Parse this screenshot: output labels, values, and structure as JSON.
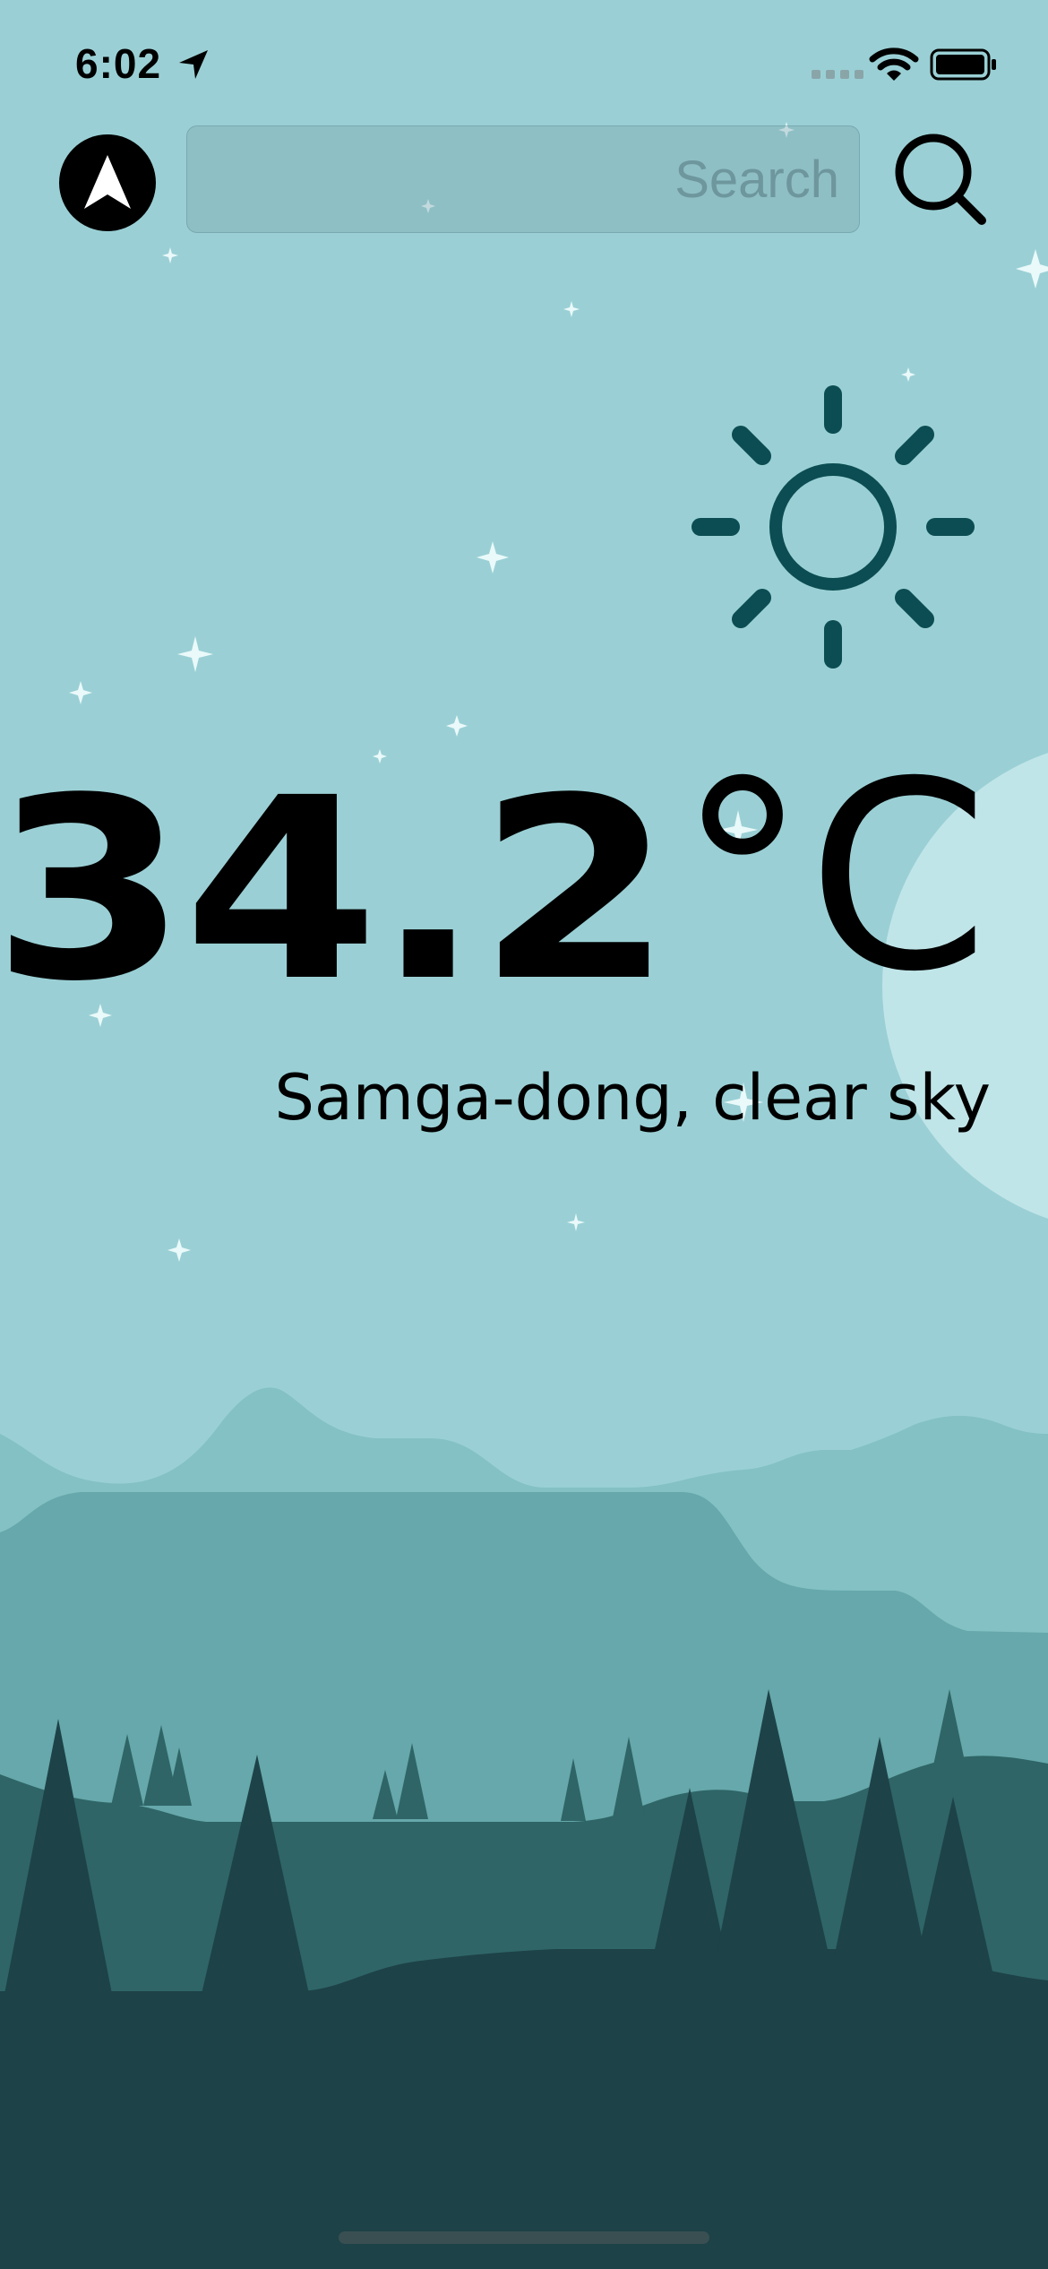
{
  "status_bar": {
    "time": "6:02",
    "icons": [
      "location-arrow-icon",
      "cellular-signal-icon",
      "wifi-icon",
      "battery-icon"
    ]
  },
  "search": {
    "placeholder": "Search",
    "value": ""
  },
  "buttons": {
    "location": "navigation-arrow-icon",
    "search": "magnifier-icon"
  },
  "weather": {
    "temperature": "34.2",
    "unit": "°C",
    "description": "Samga-dong, clear sky",
    "condition_icon": "sun-icon"
  },
  "theme": {
    "sky": "#9ad0d5",
    "moon": "#c0e5e8",
    "sun_stroke": "#0b4d52",
    "hill_light": "#84c1c4",
    "hill_mid": "#66a8ab",
    "hill_dark": "#2f6567",
    "forest": "#1d4247",
    "star": "#eaf9fa"
  }
}
